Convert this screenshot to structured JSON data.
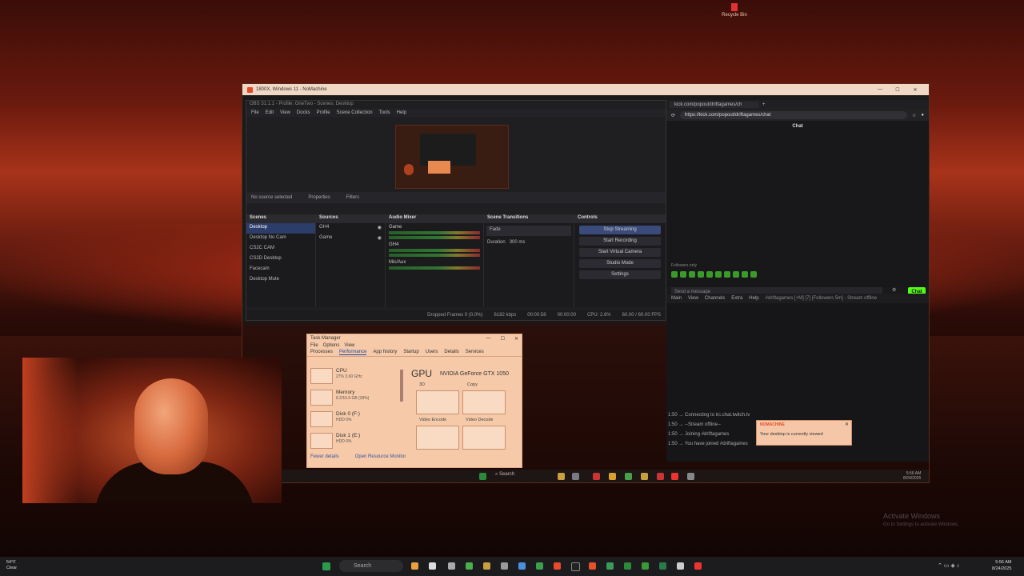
{
  "desktop": {
    "recycle_bin": "Recycle Bin",
    "watermark": [
      "Activate Windows",
      "Go to Settings to activate Windows."
    ]
  },
  "nomachine": {
    "title": "1800X, Windows 11 - NoMachine"
  },
  "obs": {
    "title": "OBS 31.1.1 - Profile: OneTwo - Scenes: Desktop",
    "menu": [
      "File",
      "Edit",
      "View",
      "Docks",
      "Profile",
      "Scene Collection",
      "Tools",
      "Help"
    ],
    "no_source": "No source selected",
    "properties": "Properties",
    "filters": "Filters",
    "scenes_header": "Scenes",
    "scenes": [
      "Desktop",
      "Desktop No Cam",
      "CS2C CAM",
      "CS2D Desktop",
      "Facecam",
      "Desktop Mute"
    ],
    "sources_header": "Sources",
    "sources": [
      "GH4",
      "Game"
    ],
    "mixer_header": "Audio Mixer",
    "mixer_channels": [
      "Game",
      "GH4",
      "Mic/Aux"
    ],
    "transitions_header": "Scene Transitions",
    "transition_value": "Fade",
    "duration_label": "Duration",
    "duration_value": "300 ms",
    "controls_header": "Controls",
    "controls": [
      "Stop Streaming",
      "Start Recording",
      "Start Virtual Camera",
      "Studio Mode",
      "Settings"
    ],
    "status": [
      "Dropped Frames 0 (0.0%)",
      "6182 kbps",
      "00:00:58",
      "00:00:00",
      "CPU: 2.6%",
      "60.00 / 60.00 FPS"
    ]
  },
  "browser": {
    "tab": "kick.com/popout/driftagames/ch",
    "url": "https://kick.com/popout/driftagames/chat",
    "chat_header": "Chat",
    "followers_only": "Followers only",
    "placeholder": "Send a message",
    "chat_button": "Chat"
  },
  "irc": {
    "menu": [
      "Main",
      "View",
      "Channels",
      "Extra",
      "Help"
    ],
    "title": "#driftagames [+M] [7] [Followers 5m] - Stream offline",
    "log": [
      "1:50 → Connecting to irc.chat.twitch.tv",
      "1:50 → --Stream offline--",
      "1:50 → Joining #driftagames",
      "1:50 → You have joined #driftagames"
    ]
  },
  "taskmanager": {
    "title": "Task Manager",
    "menu": [
      "File",
      "Options",
      "View"
    ],
    "tabs": [
      "Processes",
      "Performance",
      "App history",
      "Startup",
      "Users",
      "Details",
      "Services"
    ],
    "items": [
      {
        "name": "CPU",
        "sub": "27% 3.60 GHz"
      },
      {
        "name": "Memory",
        "sub": "6.2/15.9 GB (39%)"
      },
      {
        "name": "Disk 0 (F:)",
        "sub": "HDD 0%"
      },
      {
        "name": "Disk 1 (E:)",
        "sub": "HDD 0%"
      }
    ],
    "gpu_label": "GPU",
    "gpu_name": "NVIDIA GeForce GTX 1050",
    "graphs": [
      "3D",
      "Copy",
      "Video Encode",
      "Video Decode"
    ],
    "footer": [
      "Fewer details",
      "Open Resource Monitor"
    ]
  },
  "notification": {
    "app": "NOMACHINE",
    "message": "Your desktop is currently viewed"
  },
  "remote_taskbar": {
    "search": "Search",
    "time": "5:56 AM",
    "date": "8/24/2025"
  },
  "local_taskbar": {
    "weather_temp": "54°F",
    "weather_desc": "Clear",
    "search": "Search",
    "time": "5:56 AM",
    "date": "8/24/2025"
  },
  "colors": {
    "accent_kick": "#53fc18",
    "obs_selected": "#2d3d6a",
    "taskmanager_bg": "#f6c9a8"
  }
}
